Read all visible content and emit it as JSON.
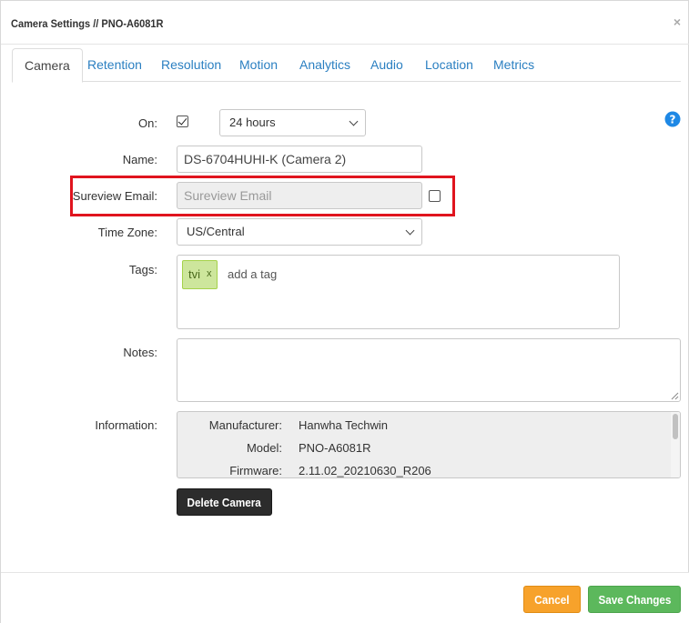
{
  "modal": {
    "title": "Camera Settings // PNO-A6081R",
    "close_label": "×"
  },
  "tabs": [
    {
      "label": "Camera",
      "active": true
    },
    {
      "label": "Retention",
      "active": false
    },
    {
      "label": "Resolution",
      "active": false
    },
    {
      "label": "Motion",
      "active": false
    },
    {
      "label": "Analytics",
      "active": false
    },
    {
      "label": "Audio",
      "active": false
    },
    {
      "label": "Location",
      "active": false
    },
    {
      "label": "Metrics",
      "active": false
    }
  ],
  "form": {
    "on_label": "On:",
    "on_checked": true,
    "schedule_value": "24 hours",
    "name_label": "Name:",
    "name_value": "DS-6704HUHI-K (Camera 2)",
    "sureview_label": "Sureview Email:",
    "sureview_placeholder": "Sureview Email",
    "sureview_checked": false,
    "timezone_label": "Time Zone:",
    "timezone_value": "US/Central",
    "tags_label": "Tags:",
    "tags": [
      {
        "text": "tvi",
        "remove": "x"
      }
    ],
    "tags_placeholder": "add a tag",
    "notes_label": "Notes:",
    "notes_value": "",
    "information_label": "Information:",
    "information": [
      {
        "key": "Manufacturer:",
        "value": "Hanwha Techwin"
      },
      {
        "key": "Model:",
        "value": "PNO-A6081R"
      },
      {
        "key": "Firmware:",
        "value": "2.11.02_20210630_R206"
      }
    ]
  },
  "buttons": {
    "delete_camera": "Delete Camera",
    "cancel": "Cancel",
    "save": "Save Changes"
  },
  "colors": {
    "tab_link": "#2a7fc1",
    "highlight_border": "#e0141e",
    "cancel_bg": "#f7a22b",
    "save_bg": "#5cb85c",
    "delete_bg": "#2c2c2c",
    "tag_bg": "#cde69c",
    "help_icon": "#1e88e5"
  },
  "icons": {
    "help": "question-circle-icon",
    "close": "close-icon",
    "select_chevron": "chevron-down-icon"
  }
}
